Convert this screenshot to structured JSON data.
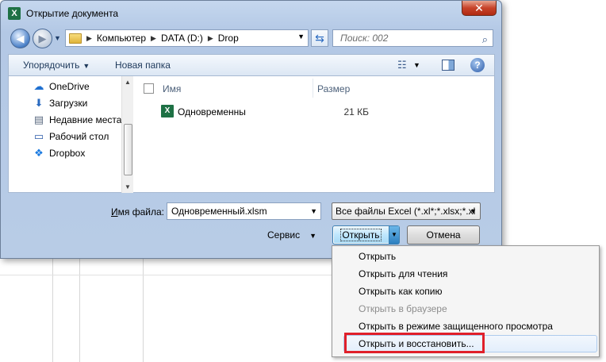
{
  "window": {
    "title": "Открытие документа",
    "app_icon_letter": "X",
    "close_glyph": "✕"
  },
  "navigation": {
    "back_glyph": "◀",
    "forward_glyph": "▶",
    "recent_glyph": "▼"
  },
  "address": {
    "crumbs": [
      "Компьютер",
      "DATA (D:)",
      "Drop"
    ],
    "separator": "▶",
    "dropdown_glyph": "▼",
    "refresh_glyph": "⇆"
  },
  "search": {
    "placeholder": "Поиск: 002",
    "icon": "search-icon"
  },
  "toolbar": {
    "organize_label": "Упорядочить",
    "organize_dd": "▼",
    "new_folder_label": "Новая папка",
    "view_glyph": "☷",
    "view_dd": "▼",
    "help_glyph": "?"
  },
  "nav_pane": {
    "items": [
      {
        "label": "OneDrive",
        "icon": "cloud-icon",
        "glyph": "☁",
        "color": "#1e6fd0"
      },
      {
        "label": "Загрузки",
        "icon": "downloads-icon",
        "glyph": "⬇",
        "color": "#2a6ac0"
      },
      {
        "label": "Недавние места",
        "icon": "recent-places-icon",
        "glyph": "▤",
        "color": "#5a6a80"
      },
      {
        "label": "Рабочий стол",
        "icon": "desktop-icon",
        "glyph": "▭",
        "color": "#2a5aa8"
      },
      {
        "label": "Dropbox",
        "icon": "dropbox-icon",
        "glyph": "❖",
        "color": "#1a7ae0"
      }
    ],
    "scroll_up": "▲",
    "scroll_down": "▼"
  },
  "file_list": {
    "columns": {
      "name": "Имя",
      "size": "Размер"
    },
    "rows": [
      {
        "name": "Одновременны",
        "size": "21 КБ",
        "icon_letter": "X"
      }
    ]
  },
  "filename": {
    "label_prefix": "И",
    "label_rest": "мя файла:",
    "value": "Одновременный.xlsm",
    "dd": "▼"
  },
  "filter": {
    "selected": "Все файлы Excel (*.xl*;*.xlsx;*.xl",
    "dd": "▼"
  },
  "buttons": {
    "tools_label": "Сервис",
    "tools_dd": "▼",
    "open_label": "Открыть",
    "open_split_glyph": "▼",
    "cancel_label": "Отмена"
  },
  "open_menu": {
    "items": [
      {
        "label": "Открыть",
        "disabled": false
      },
      {
        "label": "Открыть для чтения",
        "disabled": false
      },
      {
        "label": "Открыть как копию",
        "disabled": false
      },
      {
        "label": "Открыть в браузере",
        "disabled": true
      },
      {
        "label": "Открыть в режиме защищенного просмотра",
        "disabled": false
      },
      {
        "label": "Открыть и восстановить...",
        "disabled": false
      }
    ]
  },
  "colors": {
    "highlight": "#e0202a",
    "accent": "#3c7fb1",
    "excel_green": "#1e7145"
  }
}
